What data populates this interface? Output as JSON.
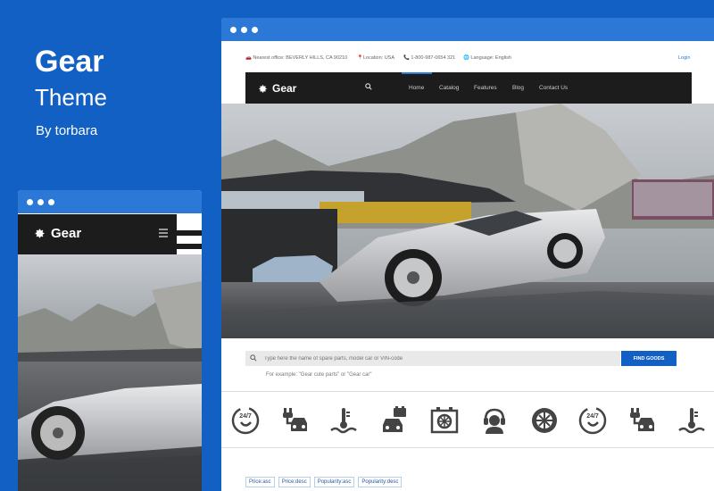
{
  "promo": {
    "title": "Gear",
    "subtitle": "Theme",
    "byline": "By torbara"
  },
  "mobile": {
    "logo": "Gear"
  },
  "desktop": {
    "topbar": {
      "office": "Nearest office: BEVERLY HILLS, CA 90210",
      "location": "Location: USA",
      "phone": "1-800-987-0654 321",
      "language": "Language: English",
      "login": "Login"
    },
    "logo": "Gear",
    "nav": [
      "Home",
      "Catalog",
      "Features",
      "Blog",
      "Contact Us"
    ],
    "search": {
      "placeholder": "Type here the name of spare parts, model car or VIN-code",
      "button": "FIND GOODS",
      "example": "For example: \"Gear cute parts\" or \"Gear car\""
    },
    "categories": [
      "24-7-icon",
      "charger-car-icon",
      "coolant-temperature-icon",
      "battery-car-icon",
      "radiator-icon",
      "support-headset-icon",
      "wheel-icon",
      "24-7-icon",
      "charger-car-icon",
      "coolant-temperature-icon"
    ],
    "sorts": [
      "Price:asc",
      "Price:desc",
      "Popularity:asc",
      "Popularity:desc"
    ]
  },
  "colors": {
    "background": "#1360c4",
    "window_bar": "#2b78d6",
    "nav": "#1c1c1c",
    "button": "#1360c4"
  }
}
